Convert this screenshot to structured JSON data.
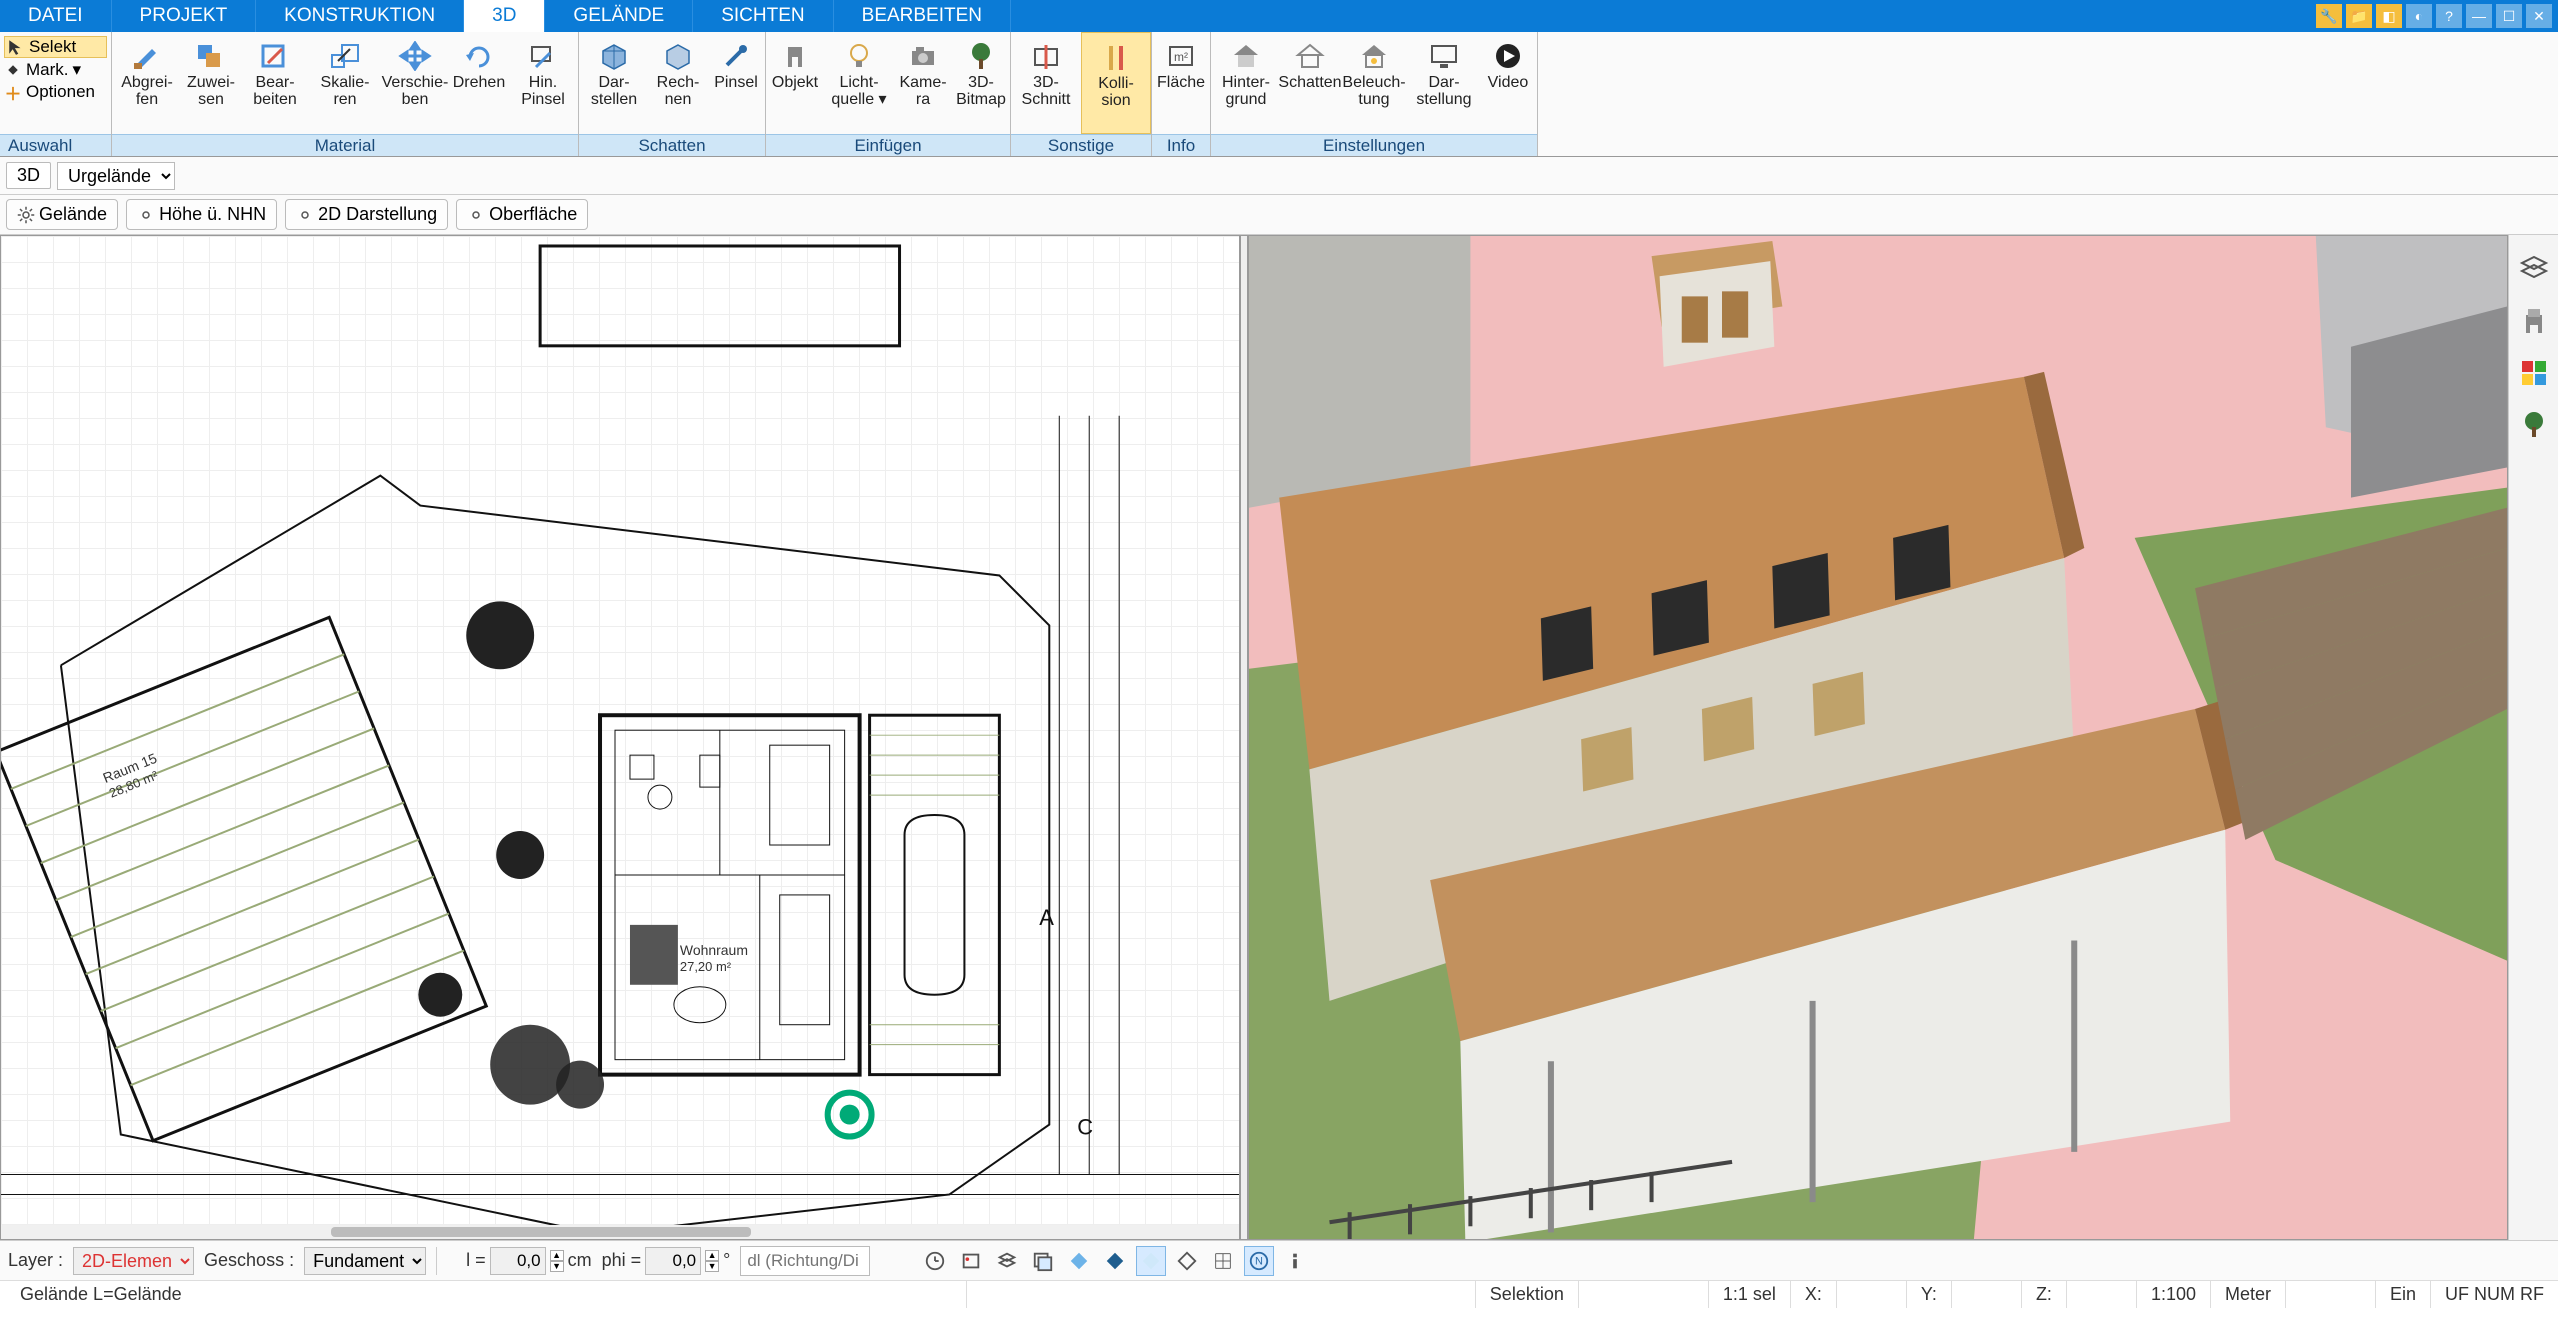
{
  "menu": {
    "tabs": [
      "DATEI",
      "PROJEKT",
      "KONSTRUKTION",
      "3D",
      "GELÄNDE",
      "SICHTEN",
      "BEARBEITEN"
    ],
    "active": "3D"
  },
  "ribbon": {
    "auswahl": {
      "selekt": "Selekt",
      "mark": "Mark.",
      "optionen": "Optionen",
      "label": "Auswahl"
    },
    "groups": [
      {
        "label": "Material",
        "buttons": [
          {
            "name": "abgreifen",
            "text": "Abgrei-\nfen",
            "ico": "brush"
          },
          {
            "name": "zuweisen",
            "text": "Zuwei-\nsen",
            "ico": "paint"
          },
          {
            "name": "bearbeiten",
            "text": "Bear-\nbeiten",
            "ico": "edit"
          },
          {
            "name": "skalieren",
            "text": "Skalie-\nren",
            "ico": "scale"
          },
          {
            "name": "verschieben",
            "text": "Verschie-\nben",
            "ico": "move"
          },
          {
            "name": "drehen",
            "text": "Drehen",
            "ico": "rotate"
          },
          {
            "name": "hin-pinsel",
            "text": "Hin.\nPinsel",
            "ico": "brush2"
          }
        ]
      },
      {
        "label": "Schatten",
        "buttons": [
          {
            "name": "darstellen",
            "text": "Dar-\nstellen",
            "ico": "cube"
          },
          {
            "name": "rechnen",
            "text": "Rech-\nnen",
            "ico": "cube2"
          },
          {
            "name": "pinsel",
            "text": "Pinsel",
            "ico": "brush3"
          }
        ]
      },
      {
        "label": "Einfügen",
        "buttons": [
          {
            "name": "objekt",
            "text": "Objekt",
            "ico": "chair"
          },
          {
            "name": "lichtquelle",
            "text": "Licht-\nquelle ▾",
            "ico": "bulb"
          },
          {
            "name": "kamera",
            "text": "Kame-\nra",
            "ico": "camera"
          },
          {
            "name": "3d-bitmap",
            "text": "3D-\nBitmap",
            "ico": "tree"
          }
        ]
      },
      {
        "label": "Sonstige",
        "buttons": [
          {
            "name": "3d-schnitt",
            "text": "3D-\nSchnitt",
            "ico": "section"
          },
          {
            "name": "kollision",
            "text": "Kolli-\nsion",
            "ico": "collision",
            "active": true
          }
        ]
      },
      {
        "label": "Info",
        "buttons": [
          {
            "name": "flaeche",
            "text": "Fläche",
            "ico": "area"
          }
        ]
      },
      {
        "label": "Einstellungen",
        "buttons": [
          {
            "name": "hintergrund",
            "text": "Hinter-\ngrund",
            "ico": "house"
          },
          {
            "name": "schatten2",
            "text": "Schatten",
            "ico": "house2"
          },
          {
            "name": "beleuchtung",
            "text": "Beleuch-\ntung",
            "ico": "house3"
          },
          {
            "name": "darstellung",
            "text": "Dar-\nstellung",
            "ico": "monitor"
          },
          {
            "name": "video",
            "text": "Video",
            "ico": "play"
          }
        ]
      }
    ]
  },
  "subbar": {
    "mode_label": "3D",
    "mode_value": "Urgelände",
    "options": [
      "Gelände",
      "Höhe ü. NHN",
      "2D Darstellung",
      "Oberfläche"
    ]
  },
  "plan": {
    "rooms": [
      {
        "name": "Raum 15",
        "area": "28,80 m²"
      },
      {
        "name": "Wohnraum",
        "area": "27,20 m²"
      }
    ]
  },
  "sidebar_icons": [
    "layers-icon",
    "furniture-icon",
    "materials-icon",
    "plant-icon"
  ],
  "bottombar": {
    "layer_label": "Layer :",
    "layer_value": "2D-Elemen",
    "geschoss_label": "Geschoss :",
    "geschoss_value": "Fundament",
    "l_label": "l =",
    "l_value": "0,0",
    "l_unit": "cm",
    "phi_label": "phi =",
    "phi_value": "0,0",
    "dir_placeholder": "dl (Richtung/Di"
  },
  "statusbar": {
    "left": "Gelände L=Gelände",
    "sel": "Selektion",
    "ratio": "1:1 sel",
    "x": "X:",
    "y": "Y:",
    "z": "Z:",
    "scale": "1:100",
    "unit": "Meter",
    "ein": "Ein",
    "flags": "UF NUM RF"
  }
}
